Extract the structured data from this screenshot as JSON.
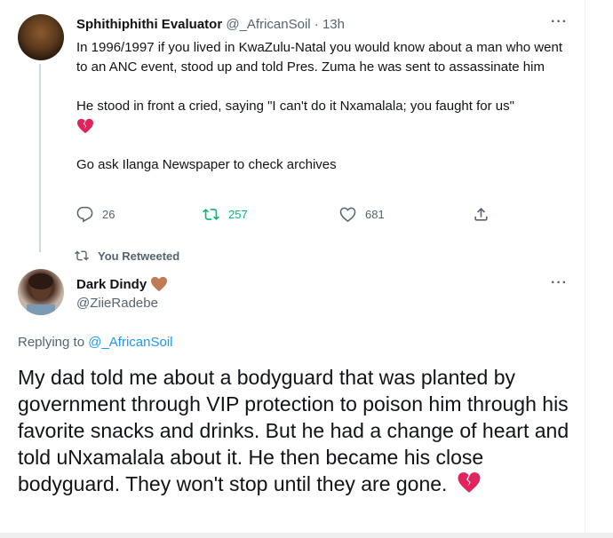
{
  "tweet1": {
    "display_name": "Sphithiphithi Evaluator",
    "handle": "@_AfricanSoil",
    "separator": "·",
    "time": "13h",
    "more": "···",
    "line1": "In 1996/1997 if you lived in KwaZulu-Natal you would know about a man who went to an ANC event, stood up and told Pres. Zuma he was sent to assassinate him",
    "line2": "He stood in front a cried, saying \"I can't do it Nxamalala; you faught for us\"",
    "line3": "Go ask Ilanga Newspaper to check archives",
    "emoji": "broken-heart-icon",
    "reply_count": "26",
    "retweet_count": "257",
    "like_count": "681"
  },
  "retweet_banner": {
    "label": "You Retweeted"
  },
  "tweet2": {
    "display_name": "Dark Dindy",
    "name_emoji": "heart-icon",
    "handle": "@ZiieRadebe",
    "more": "···",
    "replying_prefix": "Replying to",
    "replying_handle": "@_AfricanSoil",
    "text": "My dad told me about a bodyguard that was planted by government through VIP protection to poison him through his favorite snacks and drinks. But he had a change of heart and told uNxamalala about it. He then became his close bodyguard. They won't stop until they are gone."
  },
  "colors": {
    "retweet_active": "#00ba7c",
    "link": "#1d9bf0",
    "muted": "#536471",
    "broken_heart": "#e0245e",
    "brown_heart": "#c07a55"
  }
}
